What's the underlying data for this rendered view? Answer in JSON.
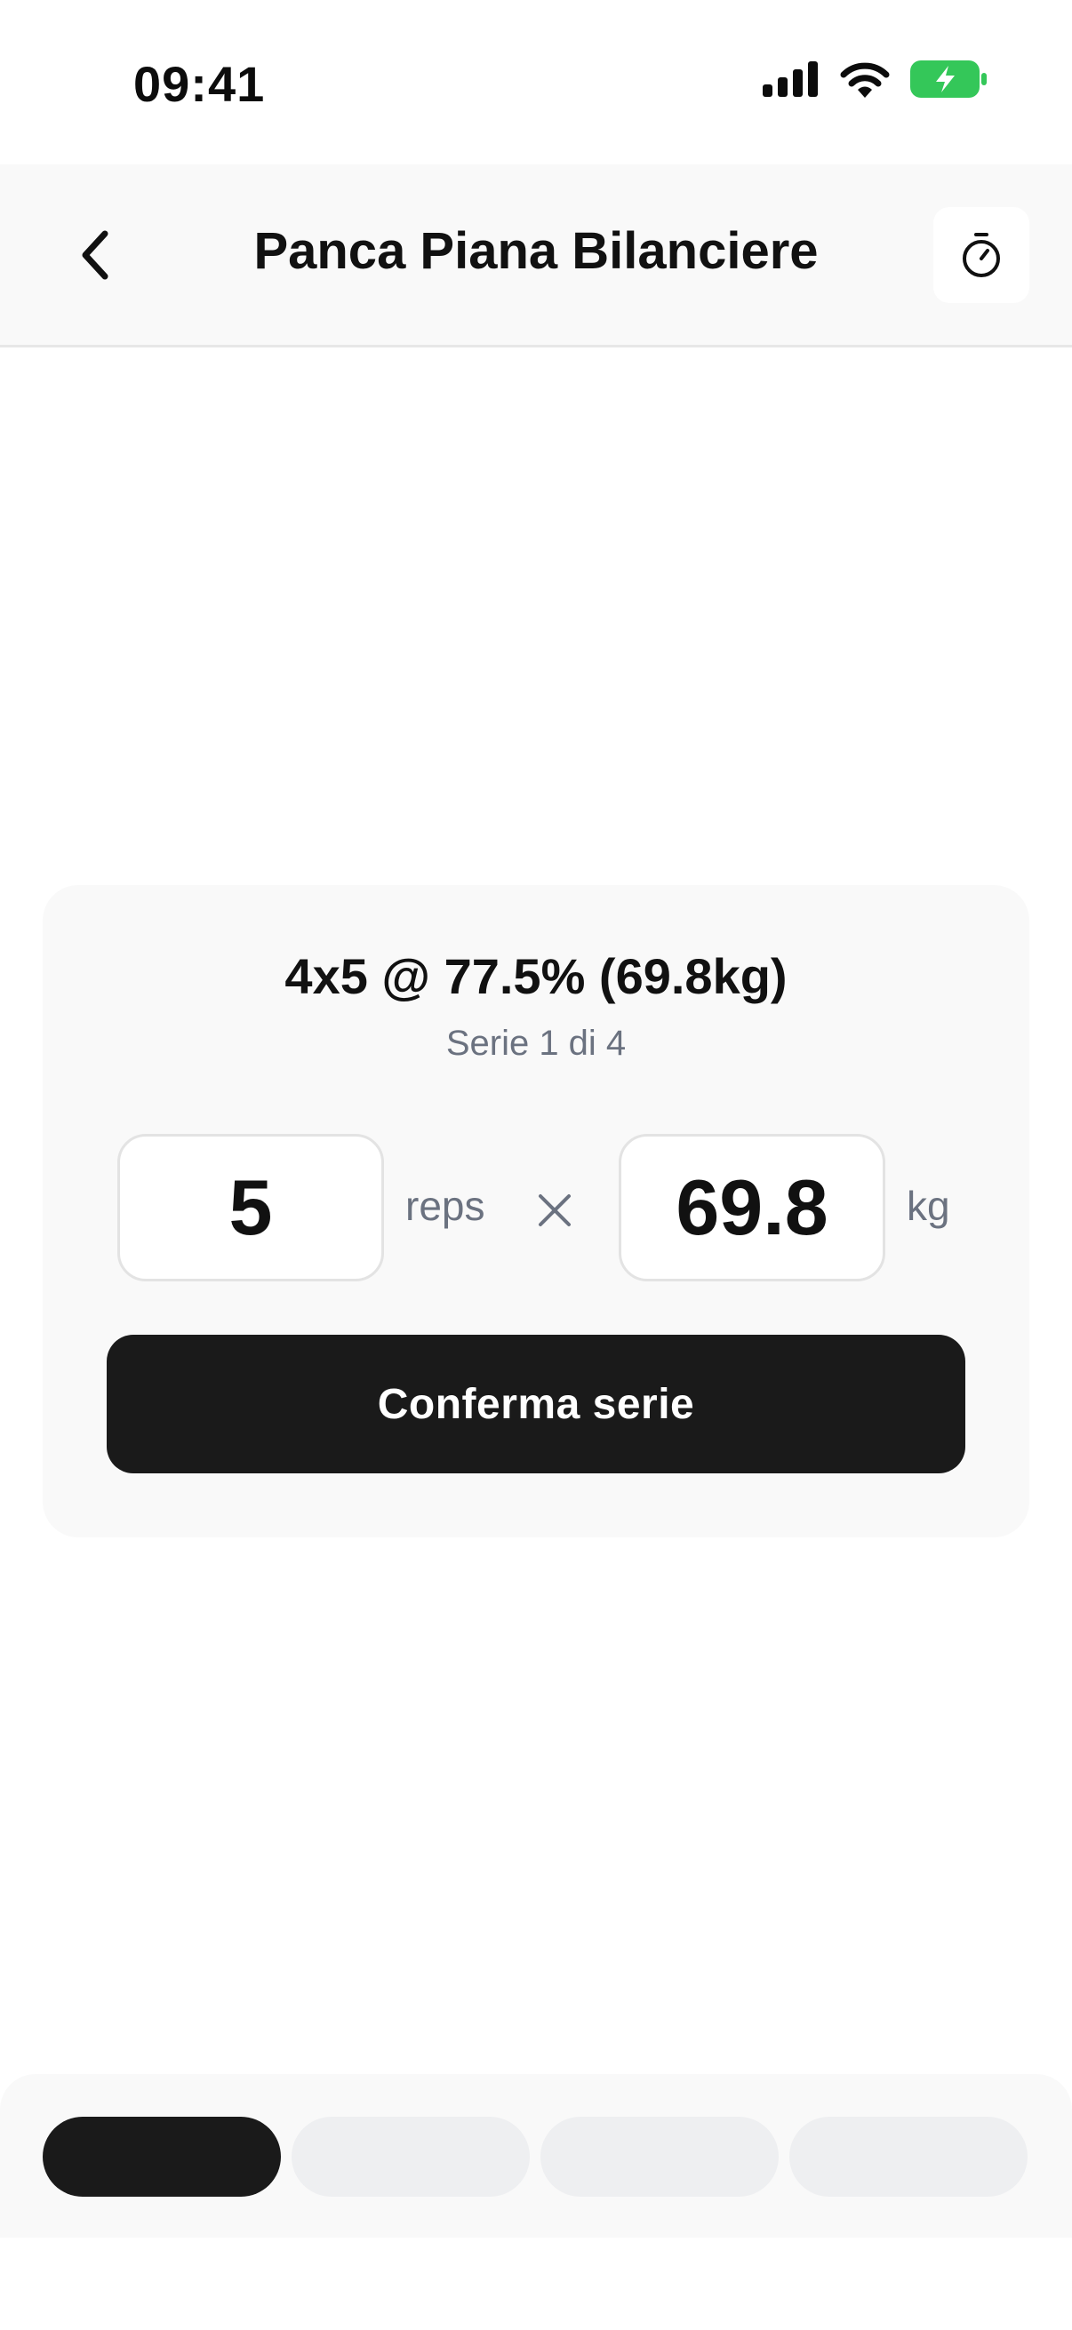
{
  "status_bar": {
    "time": "09:41",
    "icons": [
      "cellular-signal-icon",
      "wifi-icon",
      "battery-charging-icon"
    ],
    "battery_color": "#34c759"
  },
  "header": {
    "title": "Panca Piana Bilanciere",
    "back_icon": "chevron-left-icon",
    "timer_icon": "stopwatch-icon"
  },
  "set_card": {
    "scheme": "4x5 @ 77.5% (69.8kg)",
    "progress": "Serie 1 di 4",
    "reps_value": "5",
    "reps_unit": "reps",
    "weight_value": "69.8",
    "weight_unit": "kg",
    "confirm_label": "Conferma serie"
  },
  "set_indicator": {
    "total_sets": 4,
    "current_set": 1,
    "active_color": "#1a1a1a",
    "inactive_color": "#eeeff1"
  }
}
